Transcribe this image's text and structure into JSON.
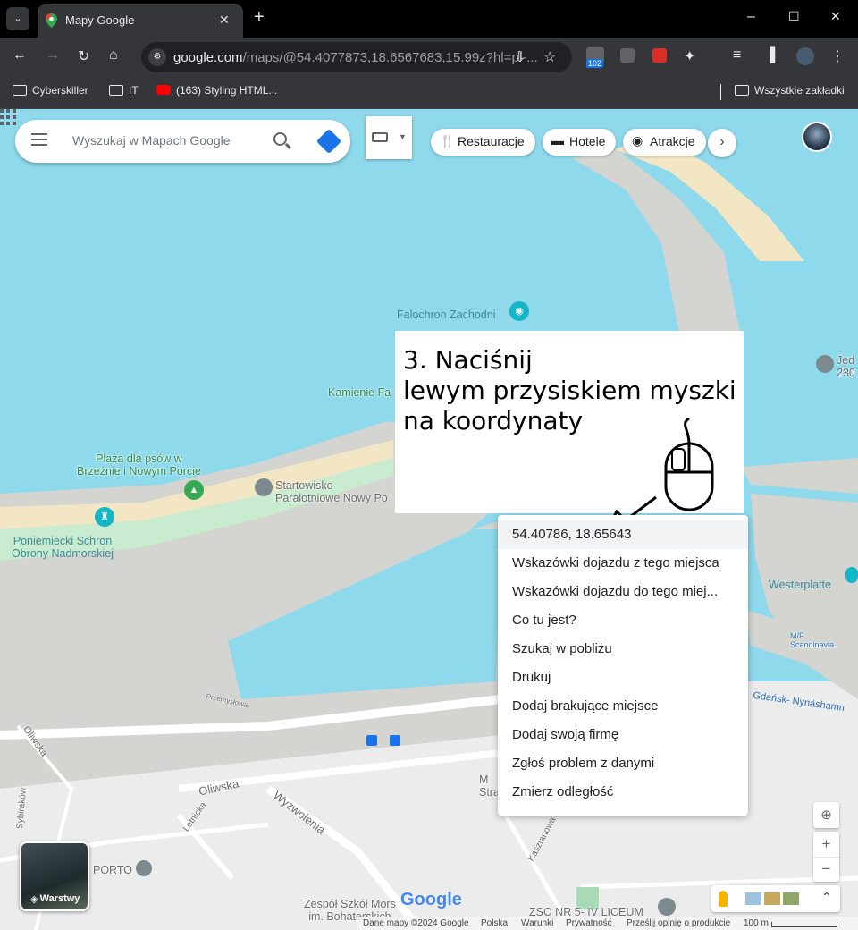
{
  "browser": {
    "tab_title": "Mapy Google",
    "new_tab": "+",
    "url_main": "google.com",
    "url_rest": "/maps/@54.4077873,18.6567683,15.99z?hl=pl-...",
    "extension_badge": "102",
    "window_controls": [
      "–",
      "☐",
      "✕"
    ]
  },
  "bookmarks": {
    "items": [
      "Cyberskiller",
      "IT",
      "(163) Styling HTML..."
    ],
    "all_bookmarks": "Wszystkie zakładki"
  },
  "maps": {
    "search_placeholder": "Wyszukaj w Mapach Google",
    "chips": [
      "Restauracje",
      "Hotele",
      "Atrakcje"
    ],
    "layers_label": "Warstwy",
    "labels": {
      "falochron": "Falochron Zachodni",
      "kamienie": "Kamienie Fa",
      "plaza": "Plaża dla psów w\nBrzeźnie i Nowym Porcie",
      "startowisko": "Startowisko\nParalotniowe Nowy Po",
      "schron": "Poniemiecki Schron\nObrony Nadmorskiej",
      "westerplatte": "Westerplatte",
      "jed": "Jed\n230",
      "scandinavia": "M/F\nScandinavia",
      "gdansk_nynashamn": "Gdańsk- Nynäshamn",
      "oliwska1": "Oliwska",
      "oliwska2": "Oliwska",
      "wyzwolenia": "Wyzwolenia",
      "letnicka": "Letnicka",
      "sybirakow": "Sybiraków",
      "porto": "PORTO",
      "kasztanowa": "Kasztanowa",
      "przemyslowa": "Przemysłowa",
      "zespol": "Zespół Szkół Mors\nim. Bohaterskich",
      "zso": "ZSO NR 5- IV LICEUM",
      "stra": "M\nStra"
    },
    "footer": [
      "Dane mapy ©2024 Google",
      "Polska",
      "Warunki",
      "Prywatność",
      "Prześlij opinię o produkcie",
      "100 m"
    ],
    "google_logo": "Google"
  },
  "instruction": {
    "text": "3. Naciśnij\nlewym przysiskiem myszki\nna koordynaty"
  },
  "context_menu": {
    "items": [
      "54.40786, 18.65643",
      "Wskazówki dojazdu z tego miejsca",
      "Wskazówki dojazdu do tego miej...",
      "Co tu jest?",
      "Szukaj w pobliżu",
      "Drukuj",
      "Dodaj brakujące miejsce",
      "Dodaj swoją firmę",
      "Zgłoś problem z danymi",
      "Zmierz odległość"
    ]
  },
  "colors": {
    "water": "#8ed9ec",
    "land": "#d4d4d0",
    "beach": "#f3e6c4",
    "park": "#c9ecd0",
    "accent": "#1a73e8"
  }
}
